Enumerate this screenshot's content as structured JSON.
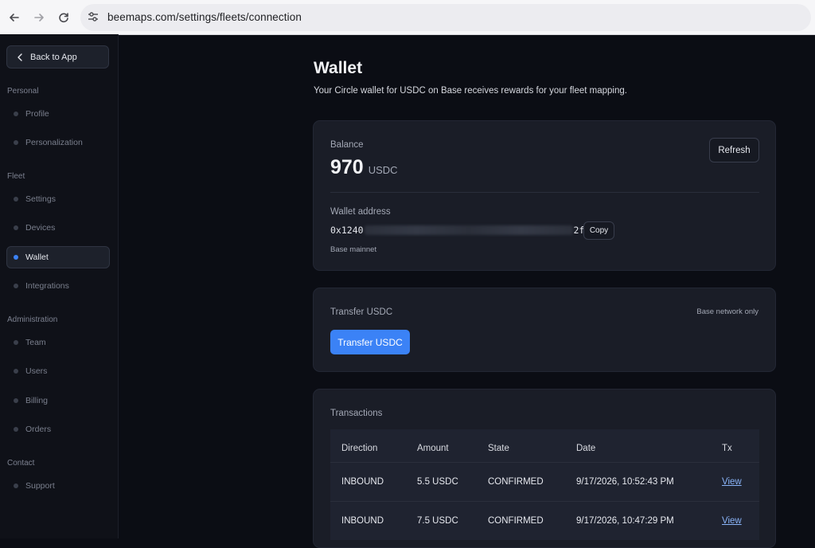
{
  "browser": {
    "url": "beemaps.com/settings/fleets/connection",
    "icons": [
      "back-arrow-icon",
      "forward-arrow-icon",
      "reload-icon",
      "site-settings-icon"
    ]
  },
  "sidebar": {
    "back_label": "Back to App",
    "sections": [
      {
        "label": "Personal",
        "items": [
          "Profile",
          "Personalization"
        ]
      },
      {
        "label": "Fleet",
        "items": [
          "Settings",
          "Devices",
          "Wallet",
          "Integrations"
        ]
      },
      {
        "label": "Administration",
        "items": [
          "Team",
          "Users",
          "Billing",
          "Orders"
        ]
      },
      {
        "label": "Contact",
        "items": [
          "Support"
        ]
      }
    ],
    "active_item": "Wallet"
  },
  "main": {
    "title": "Wallet",
    "subtitle": "Your Circle wallet for USDC on Base receives rewards for your fleet mapping."
  },
  "balance_card": {
    "balance_label": "Balance",
    "balance_value": "970",
    "balance_unit": "USDC",
    "refresh_label": "Refresh",
    "address_label": "Wallet address",
    "address_prefix": "0x1240",
    "address_suffix": "2fa1",
    "copy_label": "Copy",
    "network": "Base mainnet"
  },
  "transfer_card": {
    "title": "Transfer USDC",
    "note": "Base network only",
    "button_label": "Transfer USDC"
  },
  "transactions": {
    "title": "Transactions",
    "columns": [
      "Direction",
      "Amount",
      "State",
      "Date",
      "Tx"
    ],
    "rows": [
      {
        "direction": "INBOUND",
        "amount": "5.5 USDC",
        "state": "CONFIRMED",
        "date": "9/17/2026, 10:52:43 PM",
        "tx": "View"
      },
      {
        "direction": "INBOUND",
        "amount": "7.5 USDC",
        "state": "CONFIRMED",
        "date": "9/17/2026, 10:47:29 PM",
        "tx": "View"
      }
    ]
  },
  "colors": {
    "accent": "#3b82f6",
    "background": "#0b0d14",
    "card": "#1a1d27",
    "link": "#8ab4f8"
  }
}
